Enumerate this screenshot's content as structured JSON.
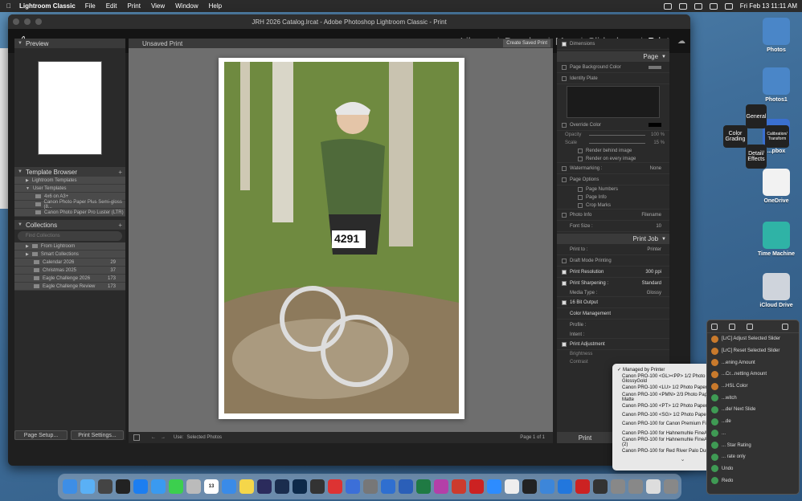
{
  "menubar": {
    "app": "Lightroom Classic",
    "items": [
      "File",
      "Edit",
      "Print",
      "View",
      "Window",
      "Help"
    ],
    "datetime": "Fri Feb 13  11:11 AM"
  },
  "window": {
    "title": "JRH 2026 Catalog.lrcat - Adobe Photoshop Lightroom Classic - Print"
  },
  "modules": [
    "Library",
    "Develop",
    "Map",
    "Slideshow",
    "Print"
  ],
  "active_module": "Print",
  "left_panel": {
    "preview_title": "Preview",
    "template_browser": {
      "title": "Template Browser",
      "items": [
        "Lightroom Templates",
        "User Templates",
        "4x6 on A3+",
        "Canon Photo Paper Plus Semi-gloss (8...",
        "Canon Photo Paper Pro Luster (LTR)"
      ]
    },
    "collections": {
      "title": "Collections",
      "search_placeholder": "Find Collections",
      "items": [
        {
          "name": "From Lightroom",
          "count": ""
        },
        {
          "name": "Smart Collections",
          "count": ""
        },
        {
          "name": "Calendar 2026",
          "count": "29"
        },
        {
          "name": "Christmas 2025",
          "count": "37"
        },
        {
          "name": "Eagle Challenge 2026",
          "count": "173"
        },
        {
          "name": "Eagle Challenge Review",
          "count": "173"
        }
      ]
    },
    "page_setup": "Page Setup...",
    "print_settings": "Print Settings..."
  },
  "center": {
    "title": "Unsaved Print",
    "create_saved": "Create Saved Print",
    "use_label": "Use:",
    "use_value": "Selected Photos",
    "page_info": "Page 1 of 1",
    "bib_number": "4291"
  },
  "right_panel": {
    "dimensions": "Dimensions",
    "page_section": "Page",
    "page_bg": "Page Background Color",
    "identity_plate": "Identity Plate",
    "override_color": "Override Color",
    "opacity_label": "Opacity",
    "opacity_val": "100 %",
    "scale_label": "Scale",
    "scale_val": "15 %",
    "render_behind": "Render behind image",
    "render_every": "Render on every image",
    "watermarking": "Watermarking :",
    "watermark_val": "None",
    "page_options": "Page Options",
    "page_numbers": "Page Numbers",
    "page_info_opt": "Page Info",
    "crop_marks": "Crop Marks",
    "photo_info": "Photo Info",
    "photo_info_val": "Filename",
    "font_size": "Font Size :",
    "font_size_val": "10",
    "print_job": "Print Job",
    "print_to": "Print to :",
    "print_to_val": "Printer",
    "draft_mode": "Draft Mode Printing",
    "print_resolution": "Print Resolution",
    "print_res_val": "300 ppi",
    "print_sharpening": "Print Sharpening :",
    "sharpen_val": "Standard",
    "media_type": "Media Type :",
    "media_val": "Glossy",
    "bit_output": "16 Bit Output",
    "color_mgmt": "Color Management",
    "profile_label": "Profile :",
    "intent_label": "Intent :",
    "print_adjust": "Print Adjustment",
    "brightness": "Brightness",
    "contrast": "Contrast",
    "print_button": "Print"
  },
  "profile_dropdown": {
    "selected": "Managed by Printer",
    "items": [
      "Canon PRO-100 <GL><PP> 1/2 Photo Paper Plus GlossyGold",
      "Canon PRO-100 <LU> 1/2 Photo Paper Pro Luster",
      "Canon PRO-100 <PMN> 2/3 Photo Paper Pro Premium Matte",
      "Canon PRO-100 <PT> 1/2 Photo Paper Pro Platinum",
      "Canon PRO-100 <SG> 1/2 Photo Paper Plus Semi-Gloss",
      "Canon PRO-100 for Canon Premium Fine Art Smooth.icc",
      "Canon PRO-100 for Hahnemuhle FineArt Baryta 325",
      "Canon PRO-100 for Hahnemuhle FineArt Museum Etching (2)",
      "Canon PRO-100 for Red River Palo Duro SoftGloss Rag (2)"
    ]
  },
  "radial_menu": {
    "general": "General",
    "color_grading": "Color Grading",
    "calibration": "Calibration/ Transform",
    "detail": "Detail/ Effects"
  },
  "widget": {
    "items": [
      "[LrC] Adjust Selected Slider",
      "[LrC] Reset Selected Slider",
      "...ening Amount",
      "...Cr...netting Amount",
      "...HSL Color",
      "...witch",
      "...de/ Next Slide",
      "...de",
      "...",
      "... Star Rating",
      "... rate only",
      "Undo",
      "Redo"
    ]
  },
  "desktop": [
    "Photos",
    "Photos1",
    "...pbox",
    "OneDrive",
    "Time Machine",
    "iCloud Drive"
  ],
  "dock": {
    "calendar_day": "13"
  }
}
